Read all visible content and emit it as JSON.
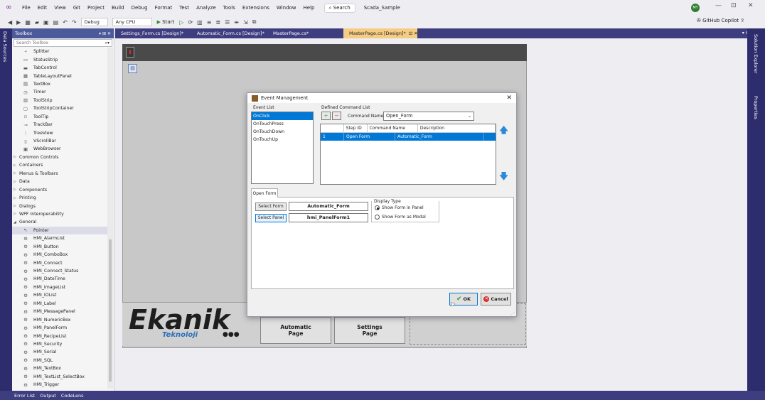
{
  "titlebar": {
    "menu": [
      "File",
      "Edit",
      "View",
      "Git",
      "Project",
      "Build",
      "Debug",
      "Format",
      "Test",
      "Analyze",
      "Tools",
      "Extensions",
      "Window",
      "Help"
    ],
    "search_label": "Search",
    "solution_name": "Scada_Sample",
    "avatar_initials": "MY",
    "window_controls": [
      "—",
      "⊡",
      "✕"
    ]
  },
  "toolbar": {
    "config": "Debug",
    "platform": "Any CPU",
    "start_label": "Start",
    "copilot_label": "GitHub Copilot"
  },
  "left_strip": {
    "label": "Data Sources"
  },
  "right_strip": {
    "labels": [
      "Solution Explorer",
      "Properties"
    ]
  },
  "toolbox": {
    "title": "Toolbox",
    "header_controls": "▾ ⊞ ✕",
    "search_placeholder": "Search Toolbox",
    "items": [
      {
        "label": "Splitter",
        "icon": "⫞",
        "type": "tool"
      },
      {
        "label": "StatusStrip",
        "icon": "▭",
        "type": "tool"
      },
      {
        "label": "TabControl",
        "icon": "▬",
        "type": "tool"
      },
      {
        "label": "TableLayoutPanel",
        "icon": "▦",
        "type": "tool"
      },
      {
        "label": "TextBox",
        "icon": "▤",
        "type": "tool"
      },
      {
        "label": "Timer",
        "icon": "◷",
        "type": "tool"
      },
      {
        "label": "ToolStrip",
        "icon": "▥",
        "type": "tool"
      },
      {
        "label": "ToolStripContainer",
        "icon": "▢",
        "type": "tool"
      },
      {
        "label": "ToolTip",
        "icon": "▫",
        "type": "tool"
      },
      {
        "label": "TrackBar",
        "icon": "⊸",
        "type": "tool"
      },
      {
        "label": "TreeView",
        "icon": "⋮",
        "type": "tool"
      },
      {
        "label": "VScrollBar",
        "icon": "▯",
        "type": "tool"
      },
      {
        "label": "WebBrowser",
        "icon": "▣",
        "type": "tool"
      },
      {
        "label": "Common Controls",
        "type": "cat"
      },
      {
        "label": "Containers",
        "type": "cat"
      },
      {
        "label": "Menus & Toolbars",
        "type": "cat"
      },
      {
        "label": "Data",
        "type": "cat"
      },
      {
        "label": "Components",
        "type": "cat"
      },
      {
        "label": "Printing",
        "type": "cat"
      },
      {
        "label": "Dialogs",
        "type": "cat"
      },
      {
        "label": "WPF Interoperability",
        "type": "cat"
      },
      {
        "label": "General",
        "type": "cat-open"
      },
      {
        "label": "Pointer",
        "icon": "↖",
        "type": "tool-sel"
      },
      {
        "label": "HMI_AlarmList",
        "icon": "⚙",
        "type": "tool"
      },
      {
        "label": "HMI_Button",
        "icon": "⚙",
        "type": "tool"
      },
      {
        "label": "HMI_ComboBox",
        "icon": "⚙",
        "type": "tool"
      },
      {
        "label": "HMI_Connect",
        "icon": "⚙",
        "type": "tool"
      },
      {
        "label": "HMI_Connect_Status",
        "icon": "⚙",
        "type": "tool"
      },
      {
        "label": "HMI_DateTime",
        "icon": "⚙",
        "type": "tool"
      },
      {
        "label": "HMI_ImageList",
        "icon": "⚙",
        "type": "tool"
      },
      {
        "label": "HMI_IOList",
        "icon": "⚙",
        "type": "tool"
      },
      {
        "label": "HMI_Label",
        "icon": "⚙",
        "type": "tool"
      },
      {
        "label": "HMI_MessagePanel",
        "icon": "⚙",
        "type": "tool"
      },
      {
        "label": "HMI_NumericBox",
        "icon": "⚙",
        "type": "tool"
      },
      {
        "label": "HMI_PanelForm",
        "icon": "⚙",
        "type": "tool"
      },
      {
        "label": "HMI_RecipeList",
        "icon": "⚙",
        "type": "tool"
      },
      {
        "label": "HMI_Security",
        "icon": "⚙",
        "type": "tool"
      },
      {
        "label": "HMI_Serial",
        "icon": "⚙",
        "type": "tool"
      },
      {
        "label": "HMI_SQL",
        "icon": "⚙",
        "type": "tool"
      },
      {
        "label": "HMI_TextBox",
        "icon": "⚙",
        "type": "tool"
      },
      {
        "label": "HMI_TextList_SelectBox",
        "icon": "⚙",
        "type": "tool"
      },
      {
        "label": "HMI_Trigger",
        "icon": "⚙",
        "type": "tool"
      }
    ]
  },
  "doc_tabs": [
    {
      "label": "Settings_Form.cs [Design]*",
      "active": false
    },
    {
      "label": "Automatic_Form.cs [Design]*",
      "active": false
    },
    {
      "label": "MasterPage.cs*",
      "active": false
    },
    {
      "label": "MasterPage.cs [Design]*",
      "active": true
    }
  ],
  "designer": {
    "logo_main": "Ekanik",
    "logo_sub": "Teknoloji",
    "logo_dots": "●●●",
    "page_buttons": [
      {
        "line1": "Automatic",
        "line2": "Page"
      },
      {
        "line1": "Settings",
        "line2": "Page"
      }
    ]
  },
  "modal": {
    "title": "Event Management",
    "event_list_label": "Event List",
    "events": [
      "OnClick",
      "OnTouchPress",
      "OnTouchDown",
      "OnTouchUp"
    ],
    "selected_event": 0,
    "defined_command_list_label": "Defined Command List",
    "command_name_label": "Command Name :",
    "command_name_value": "Open_Form",
    "grid_headers": [
      "Step ID",
      "Command Name",
      "Description"
    ],
    "grid_rows": [
      {
        "step_id": "1",
        "command": "Open Form",
        "description": "Automatic_Form"
      }
    ],
    "tab_label": "Open Form",
    "select_form_label": "Select Form",
    "select_form_value": "Automatic_Form",
    "select_panel_label": "Select Panel",
    "select_panel_value": "hmi_PanelForm1",
    "display_type_label": "Display Type",
    "display_options": [
      "Show Form in Panel",
      "Show Form as Modal"
    ],
    "display_selected": 0,
    "ok_label": "OK",
    "cancel_label": "Cancel"
  },
  "statusbar": {
    "items": [
      "Error List",
      "Output",
      "CodeLens"
    ]
  }
}
